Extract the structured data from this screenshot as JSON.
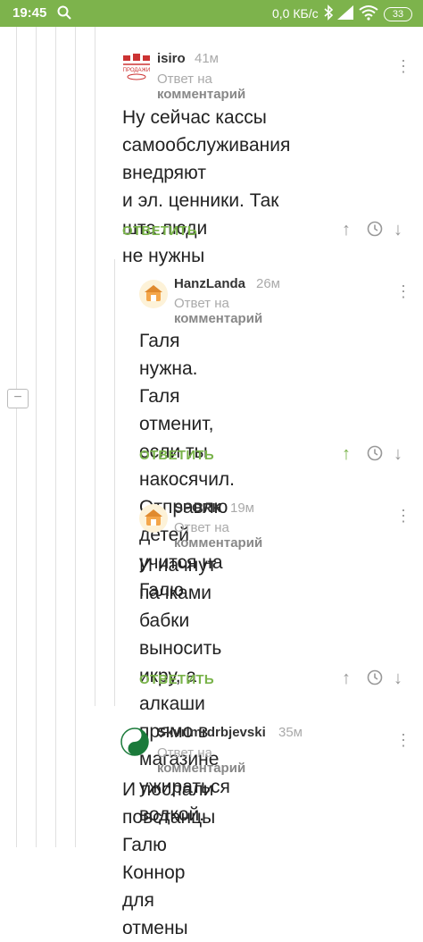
{
  "status_bar": {
    "time": "19:45",
    "net_speed": "0,0 КБ/с",
    "battery": "33"
  },
  "labels": {
    "reply_prefix": "Ответ на",
    "reply_target": "комментарий",
    "reply_button": "ОТВЕТИТЬ"
  },
  "comments": [
    {
      "author": "isiro",
      "time": "41м",
      "text": [
        "Ну сейчас кассы",
        "самообслуживания внедряют",
        "и эл. ценники. Так шта люди",
        "не нужны"
      ],
      "avatar_text": "ПРОДАЖИ"
    },
    {
      "author": "HanzLanda",
      "time": "26м",
      "text": [
        "Галя нужна. Галя отменит,",
        "если ты накосячил.",
        "Отправлю детей учится на",
        "Галю"
      ]
    },
    {
      "author": "SPORK",
      "time": "19м",
      "text": [
        "И начнут пачками бабки",
        "выносить икру, а алкаши",
        "прямо в магазине",
        "ужираться водкой."
      ]
    },
    {
      "author": "Skvrlmrdrbjevski",
      "time": "35м",
      "text": [
        "И послали повстанцы Галю",
        "Коннор для отмены"
      ]
    }
  ],
  "colors": {
    "accent": "#79b34a",
    "status_bar": "#7db34c"
  }
}
